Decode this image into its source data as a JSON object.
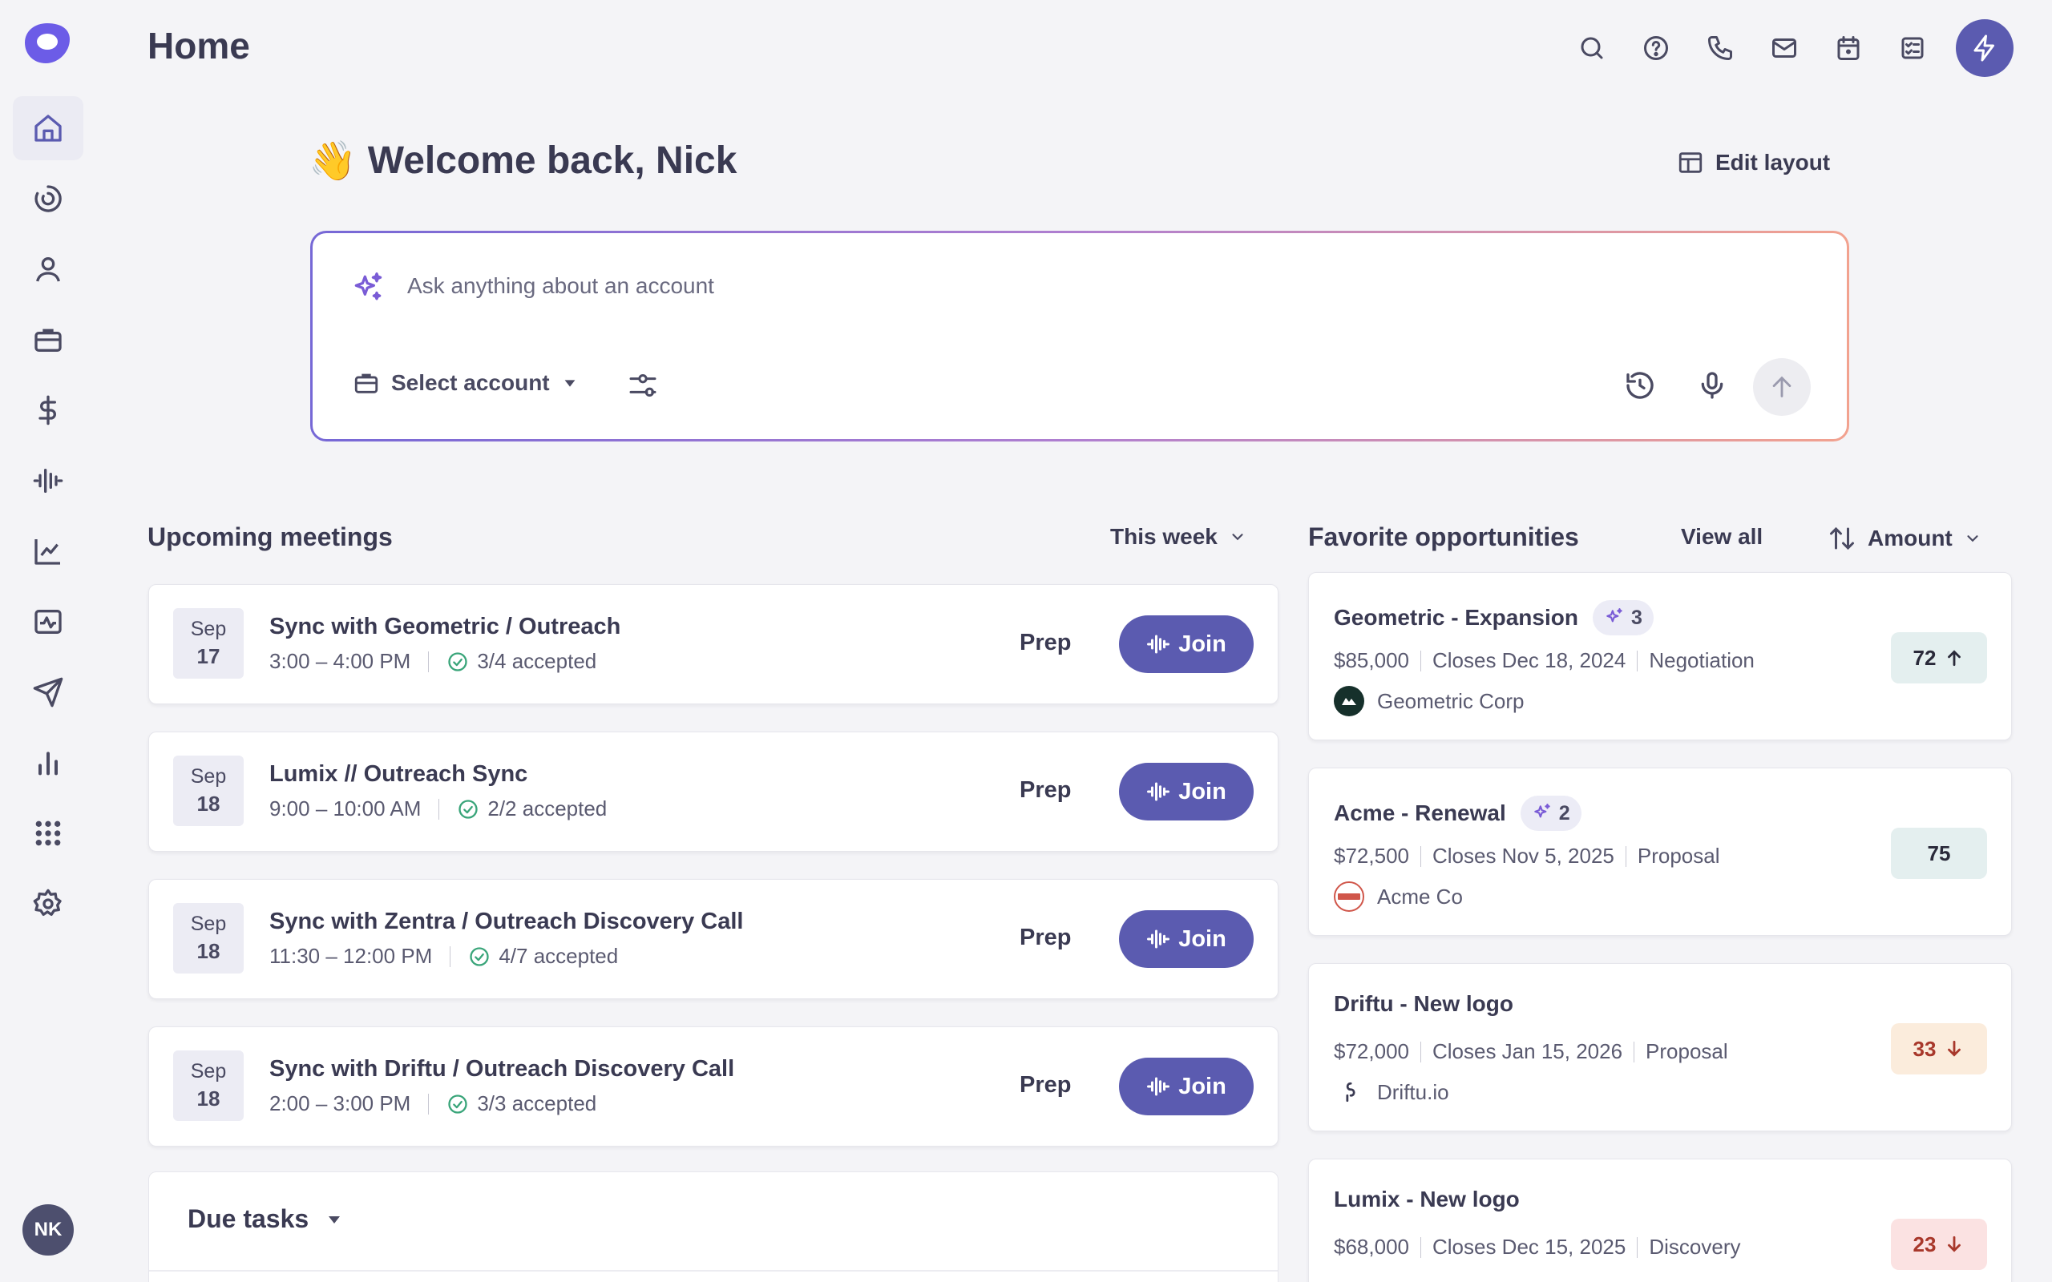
{
  "header": {
    "title": "Home",
    "icons": [
      "search-icon",
      "help-icon",
      "phone-icon",
      "mail-icon",
      "calendar-icon",
      "tasks-icon",
      "bolt-icon"
    ]
  },
  "sidebar": {
    "items": [
      {
        "name": "home",
        "icon": "home-icon",
        "active": true
      },
      {
        "name": "sequences",
        "icon": "spiral-icon"
      },
      {
        "name": "people",
        "icon": "person-icon"
      },
      {
        "name": "accounts",
        "icon": "briefcase-icon"
      },
      {
        "name": "deals",
        "icon": "dollar-icon"
      },
      {
        "name": "calls",
        "icon": "waveform-icon"
      },
      {
        "name": "analytics",
        "icon": "trend-chart-icon"
      },
      {
        "name": "pulse",
        "icon": "pulse-icon"
      },
      {
        "name": "send",
        "icon": "send-icon"
      },
      {
        "name": "reports",
        "icon": "bar-chart-icon"
      },
      {
        "name": "apps",
        "icon": "grid-icon"
      },
      {
        "name": "settings",
        "icon": "gear-icon"
      }
    ],
    "avatar": "NK"
  },
  "welcome": {
    "emoji": "👋",
    "text": "Welcome back, Nick",
    "edit_layout": "Edit layout"
  },
  "ask": {
    "placeholder": "Ask anything about an account",
    "select_account": "Select account"
  },
  "meetings": {
    "title": "Upcoming meetings",
    "range": "This week",
    "prep_label": "Prep",
    "join_label": "Join",
    "items": [
      {
        "month": "Sep",
        "day": "17",
        "title": "Sync with Geometric / Outreach",
        "time": "3:00 – 4:00 PM",
        "accepted": "3/4 accepted"
      },
      {
        "month": "Sep",
        "day": "18",
        "title": "Lumix // Outreach Sync",
        "time": "9:00 – 10:00 AM",
        "accepted": "2/2 accepted"
      },
      {
        "month": "Sep",
        "day": "18",
        "title": "Sync with Zentra / Outreach Discovery Call",
        "time": "11:30 – 12:00 PM",
        "accepted": "4/7 accepted"
      },
      {
        "month": "Sep",
        "day": "18",
        "title": "Sync with Driftu / Outreach Discovery Call",
        "time": "2:00 – 3:00 PM",
        "accepted": "3/3 accepted"
      }
    ]
  },
  "tasks": {
    "title": "Due tasks"
  },
  "opportunities": {
    "title": "Favorite opportunities",
    "view_all": "View all",
    "sort": "Amount",
    "items": [
      {
        "name": "Geometric - Expansion",
        "ai_count": "3",
        "amount": "$85,000",
        "closes": "Closes Dec 18, 2024",
        "stage": "Negotiation",
        "company": "Geometric Corp",
        "score": "72",
        "trend": "up",
        "tone": "neutral"
      },
      {
        "name": "Acme - Renewal",
        "ai_count": "2",
        "amount": "$72,500",
        "closes": "Closes Nov 5, 2025",
        "stage": "Proposal",
        "company": "Acme Co",
        "score": "75",
        "trend": "none",
        "tone": "neutral"
      },
      {
        "name": "Driftu - New logo",
        "amount": "$72,000",
        "closes": "Closes Jan 15, 2026",
        "stage": "Proposal",
        "company": "Driftu.io",
        "score": "33",
        "trend": "down",
        "tone": "warn"
      },
      {
        "name": "Lumix - New logo",
        "amount": "$68,000",
        "closes": "Closes Dec 15, 2025",
        "stage": "Discovery",
        "score": "23",
        "trend": "down",
        "tone": "bad"
      }
    ]
  },
  "colors": {
    "accent": "#5b5bb0",
    "logo": "#6c5ce7",
    "background": "#f4f4f7"
  }
}
